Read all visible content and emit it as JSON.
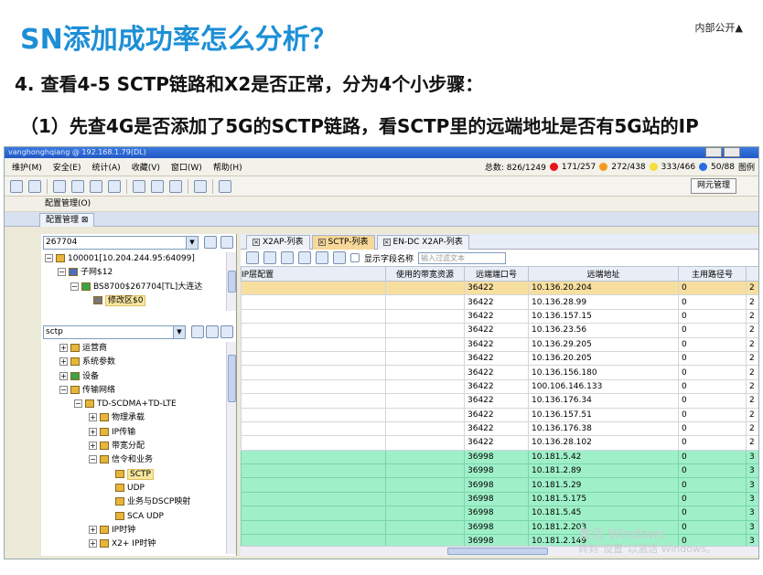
{
  "slide": {
    "title": "SN添加成功率怎么分析？",
    "badge": "内部公开▲",
    "subtitle1": "4. 查看4-5 SCTP链路和X2是否正常，分为4个小步骤：",
    "subtitle2": "（1）先查4G是否添加了5G的SCTP链路，看SCTP里的远端地址是否有5G站的IP"
  },
  "window": {
    "title": "vanghonghqiang @ 192.168.1.79(DL)",
    "menu": [
      "维护(M)",
      "安全(E)",
      "统计(A)",
      "收藏(V)",
      "窗口(W)",
      "帮助(H)"
    ],
    "stats": {
      "total": "总数: 826/1249",
      "red": "171/257",
      "orange": "272/438",
      "yellow": "333/466",
      "blue": "50/88",
      "icon_label": "图例"
    },
    "ne_button": "网元管理",
    "breadcrumb": "配置管理(O)",
    "tab": "配置管理 ⊠"
  },
  "left": {
    "search1": "267704",
    "tree1": [
      {
        "label": "100001[10.204.244.95:64099]",
        "indent": 0
      },
      {
        "label": "子网$12",
        "indent": 1
      },
      {
        "label": "BS8700$267704[TL]大连达",
        "indent": 2
      },
      {
        "label": "修改区$0",
        "indent": 3
      }
    ],
    "search2": "sctp",
    "tree2": [
      {
        "label": "运营商",
        "indent": 1
      },
      {
        "label": "系统参数",
        "indent": 1
      },
      {
        "label": "设备",
        "indent": 1
      },
      {
        "label": "传输网络",
        "indent": 1
      },
      {
        "label": "TD-SCDMA+TD-LTE",
        "indent": 2
      },
      {
        "label": "物理承载",
        "indent": 3
      },
      {
        "label": "IP传输",
        "indent": 3
      },
      {
        "label": "带宽分配",
        "indent": 3
      },
      {
        "label": "信令和业务",
        "indent": 3
      },
      {
        "label": "SCTP",
        "indent": 4
      },
      {
        "label": "UDP",
        "indent": 4
      },
      {
        "label": "业务与DSCP映射",
        "indent": 4
      },
      {
        "label": "SCA UDP",
        "indent": 4
      },
      {
        "label": "IP时钟",
        "indent": 3
      },
      {
        "label": "X2+ IP时钟",
        "indent": 3
      }
    ]
  },
  "right": {
    "tabs": [
      "X2AP-列表",
      "SCTP-列表",
      "EN-DC X2AP-列表"
    ],
    "show_field_label": "显示字段名称",
    "filter_placeholder": "输入过滤文本",
    "columns": [
      "IP层配置",
      "使用的带宽资源",
      "远端端口号",
      "远端地址",
      "主用路径号",
      ""
    ],
    "rows": [
      [
        "",
        "",
        "36422",
        "10.136.20.204",
        "0",
        "2"
      ],
      [
        "",
        "",
        "36422",
        "10.136.28.99",
        "0",
        "2"
      ],
      [
        "",
        "",
        "36422",
        "10.136.157.15",
        "0",
        "2"
      ],
      [
        "",
        "",
        "36422",
        "10.136.23.56",
        "0",
        "2"
      ],
      [
        "",
        "",
        "36422",
        "10.136.29.205",
        "0",
        "2"
      ],
      [
        "",
        "",
        "36422",
        "10.136.20.205",
        "0",
        "2"
      ],
      [
        "",
        "",
        "36422",
        "10.136.156.180",
        "0",
        "2"
      ],
      [
        "",
        "",
        "36422",
        "100.106.146.133",
        "0",
        "2"
      ],
      [
        "",
        "",
        "36422",
        "10.136.176.34",
        "0",
        "2"
      ],
      [
        "",
        "",
        "36422",
        "10.136.157.51",
        "0",
        "2"
      ],
      [
        "",
        "",
        "36422",
        "10.136.176.38",
        "0",
        "2"
      ],
      [
        "",
        "",
        "36422",
        "10.136.28.102",
        "0",
        "2"
      ],
      [
        "",
        "",
        "36998",
        "10.181.5.42",
        "0",
        "3"
      ],
      [
        "",
        "",
        "36998",
        "10.181.2.89",
        "0",
        "3"
      ],
      [
        "",
        "",
        "36998",
        "10.181.5.29",
        "0",
        "3"
      ],
      [
        "",
        "",
        "36998",
        "10.181.5.175",
        "0",
        "3"
      ],
      [
        "",
        "",
        "36998",
        "10.181.5.45",
        "0",
        "3"
      ],
      [
        "",
        "",
        "36998",
        "10.181.2.203",
        "0",
        "3"
      ],
      [
        "",
        "",
        "36998",
        "10.181.2.149",
        "0",
        "3"
      ]
    ]
  },
  "watermark": {
    "line1": "激活 Windows",
    "line2": "转到\"设置\"以激活 Windows。"
  }
}
